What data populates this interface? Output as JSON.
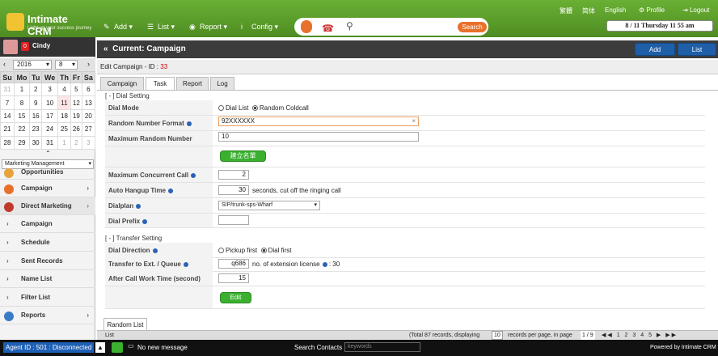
{
  "app": {
    "logo_title": "Intimate CRM",
    "logo_tagline": "Light up your success journey",
    "brand_color": "#5c9e2c"
  },
  "topnav": {
    "menus": [
      {
        "label": "Add",
        "icon": "pencil-icon"
      },
      {
        "label": "List",
        "icon": "list-icon"
      },
      {
        "label": "Report",
        "icon": "globe-icon"
      },
      {
        "label": "Config",
        "icon": "info-icon"
      }
    ],
    "search_label": "Search",
    "links": {
      "trad": "繁體",
      "simp": "简体",
      "english": "English",
      "profile": "Profile",
      "logout": "Logout"
    },
    "datetime": "8 / 11  Thursday  11 55 am"
  },
  "user": {
    "name": "Cindy",
    "badge": "0"
  },
  "calendar": {
    "year": "2016",
    "month": "8",
    "weekdays": [
      "Su",
      "Mo",
      "Tu",
      "We",
      "Th",
      "Fr",
      "Sa"
    ],
    "weeks": [
      [
        "31",
        "1",
        "2",
        "3",
        "4",
        "5",
        "6"
      ],
      [
        "7",
        "8",
        "9",
        "10",
        "11",
        "12",
        "13"
      ],
      [
        "14",
        "15",
        "16",
        "17",
        "18",
        "19",
        "20"
      ],
      [
        "21",
        "22",
        "23",
        "24",
        "25",
        "26",
        "27"
      ],
      [
        "28",
        "29",
        "30",
        "31",
        "1",
        "2",
        "3"
      ]
    ]
  },
  "sidebar": {
    "module_select": "Marketing Management",
    "items": [
      {
        "label": "Opportunities"
      },
      {
        "label": "Campaign"
      },
      {
        "label": "Direct Marketing"
      },
      {
        "label": "Campaign"
      },
      {
        "label": "Schedule"
      },
      {
        "label": "Sent Records"
      },
      {
        "label": "Name List"
      },
      {
        "label": "Filter List"
      },
      {
        "label": "Reports"
      }
    ]
  },
  "main": {
    "title": "Current: Campaign",
    "add_label": "Add",
    "list_label": "List",
    "edit_prefix": "Edit Campaign - ID : ",
    "edit_id": "33",
    "tabs": [
      "Campaign",
      "Task",
      "Report",
      "Log"
    ]
  },
  "dial": {
    "section_title": "[ - ] Dial Setting",
    "mode_label": "Dial Mode",
    "mode_opt1": "Dial List",
    "mode_opt2": "Random Coldcall",
    "rnf_label": "Random Number Format",
    "rnf_value": "92XXXXXX",
    "max_label": "Maximum Random Number",
    "max_value": "10",
    "build_button": "建立名單",
    "concurrent_label": "Maximum Concurrent Call",
    "concurrent_value": "2",
    "hangup_label": "Auto Hangup Time",
    "hangup_value": "30",
    "hangup_suffix": "seconds, cut off the ringing call",
    "dialplan_label": "Dialplan",
    "dialplan_value": "SIP/trunk-sps-Wharf",
    "prefix_label": "Dial Prefix",
    "prefix_value": ""
  },
  "transfer": {
    "section_title": "[ - ] Transfer Setting",
    "direction_label": "Dial Direction",
    "dir_opt1": "Pickup first",
    "dir_opt2": "Dial first",
    "queue_label": "Transfer to Ext. / Queue",
    "queue_value": "q686",
    "license_text": "no. of extension license",
    "license_value": ": 30",
    "acw_label": "After Call Work Time (second)",
    "acw_value": "15",
    "edit_button": "Edit"
  },
  "list": {
    "tab_label": "Random List",
    "bar_left": "List",
    "bar_info": "(Total 87 records, displaying",
    "per_page": "10",
    "per_page_suffix": "records per page, in page",
    "page_info": "1 / 9"
  },
  "status": {
    "agent": "Agent ID : 501 : Disconnected",
    "no_message": "No new message",
    "search_contacts": "Search Contacts :",
    "keywords_placeholder": "keywords",
    "powered": "Powered by Intimate CRM"
  }
}
